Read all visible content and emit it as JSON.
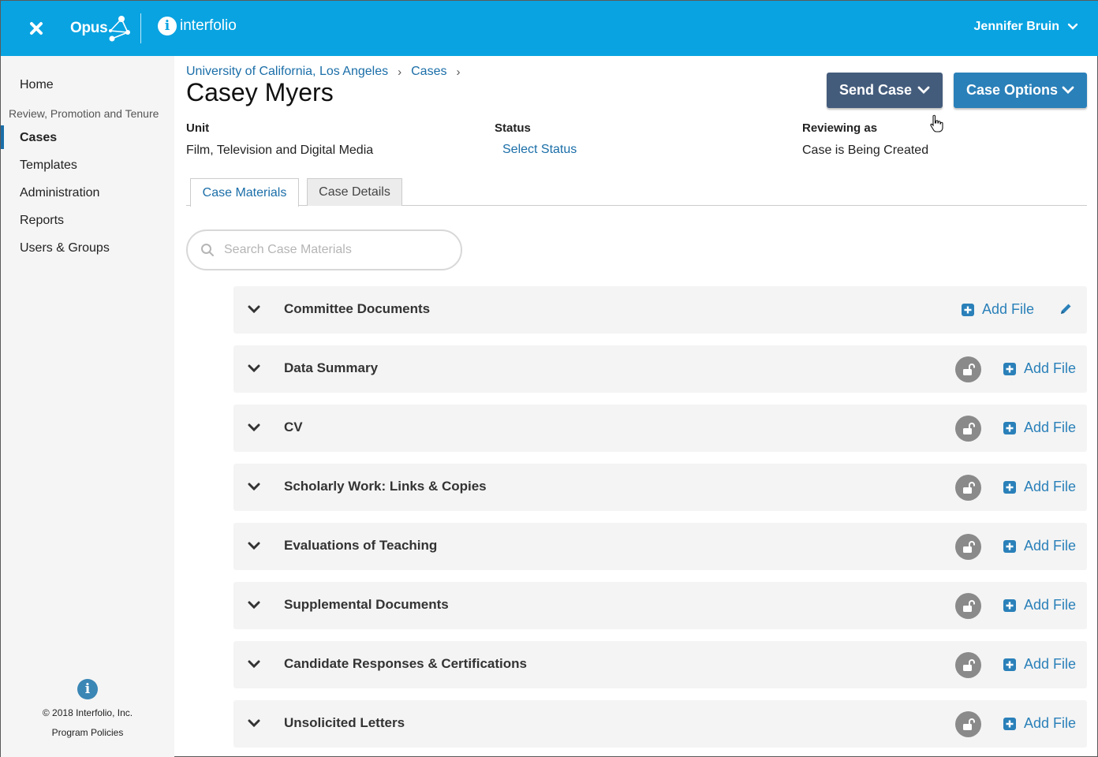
{
  "header": {
    "app_name": "Opus",
    "brand_name": "interfolio",
    "user_name": "Jennifer Bruin"
  },
  "sidebar": {
    "home": "Home",
    "section_label": "Review, Promotion and Tenure",
    "items": [
      {
        "label": "Cases"
      },
      {
        "label": "Templates"
      },
      {
        "label": "Administration"
      },
      {
        "label": "Reports"
      },
      {
        "label": "Users & Groups"
      }
    ],
    "copyright": "© 2018 Interfolio, Inc.",
    "policies": "Program Policies"
  },
  "breadcrumb": {
    "org": "University of California, Los Angeles",
    "cases": "Cases"
  },
  "page": {
    "title": "Casey Myers",
    "send_case": "Send Case",
    "case_options": "Case Options"
  },
  "meta": {
    "unit_label": "Unit",
    "unit_value": "Film, Television and Digital Media",
    "status_label": "Status",
    "status_value": "Select Status",
    "reviewing_label": "Reviewing as",
    "reviewing_value": "Case is Being Created"
  },
  "tabs": [
    {
      "label": "Case Materials"
    },
    {
      "label": "Case Details"
    }
  ],
  "search": {
    "placeholder": "Search Case Materials"
  },
  "sections": [
    {
      "title": "Committee Documents",
      "add_label": "Add File"
    },
    {
      "title": "Data Summary",
      "add_label": "Add File"
    },
    {
      "title": "CV",
      "add_label": "Add File"
    },
    {
      "title": "Scholarly Work: Links & Copies",
      "add_label": "Add File"
    },
    {
      "title": "Evaluations of Teaching",
      "add_label": "Add File"
    },
    {
      "title": "Supplemental Documents",
      "add_label": "Add File"
    },
    {
      "title": "Candidate Responses & Certifications",
      "add_label": "Add File"
    },
    {
      "title": "Unsolicited Letters",
      "add_label": "Add File"
    }
  ],
  "colors": {
    "topbar": "#09a3e1",
    "link": "#1a6ea8",
    "send_button": "#445c7c",
    "options_button": "#2a80b9"
  }
}
